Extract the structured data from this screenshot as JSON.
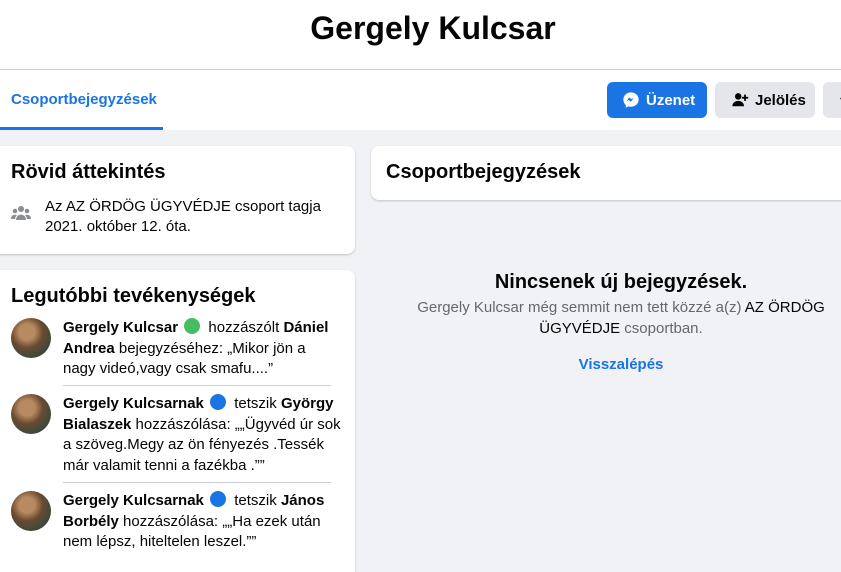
{
  "profile": {
    "name": "Gergely Kulcsar"
  },
  "tabs": [
    {
      "label": "Csoportbejegyzések",
      "active": true
    }
  ],
  "actions": {
    "message_label": "Üzenet",
    "tag_label": "Jelölés"
  },
  "intro": {
    "title": "Rövid áttekintés",
    "text_prefix": "Az ",
    "group_name": "AZ ÖRDÖG ÜGYVÉDJE",
    "text_suffix": " csoport tagja 2021. október 12. óta."
  },
  "activity": {
    "title": "Legutóbbi tevékenységek",
    "items": [
      {
        "actor": "Gergely Kulcsar",
        "badge": "comment-icon",
        "verb": "hozzászólt",
        "target": "Dániel Andrea",
        "rest": " bejegyzéséhez: „Mikor jön a nagy videó,vagy csak smafu....”"
      },
      {
        "actor": "Gergely Kulcsarnak",
        "badge": "like-icon",
        "verb": "tetszik",
        "target": "György Bialaszek",
        "rest": " hozzászólása: „„Ügyvéd úr sok a szöveg.Megy az ön fényezés .Tessék már valamit tenni a fazékba .””"
      },
      {
        "actor": "Gergely Kulcsarnak",
        "badge": "like-icon",
        "verb": "tetszik",
        "target": "János Borbély",
        "rest": " hozzászólása: „„Ha ezek után nem lépsz, hiteltelen leszel.””"
      }
    ]
  },
  "posts": {
    "title": "Csoportbejegyzések",
    "empty_title": "Nincsenek új bejegyzések.",
    "empty_prefix": "Gergely Kulcsar még semmit nem tett közzé a(z) ",
    "empty_group": "AZ ÖRDÖG ÜGYVÉDJE",
    "empty_suffix": " csoportban.",
    "back_label": "Visszalépés"
  },
  "colors": {
    "accent": "#1b74e4",
    "background": "#f0f2f5",
    "comment_badge": "#45bd62"
  }
}
